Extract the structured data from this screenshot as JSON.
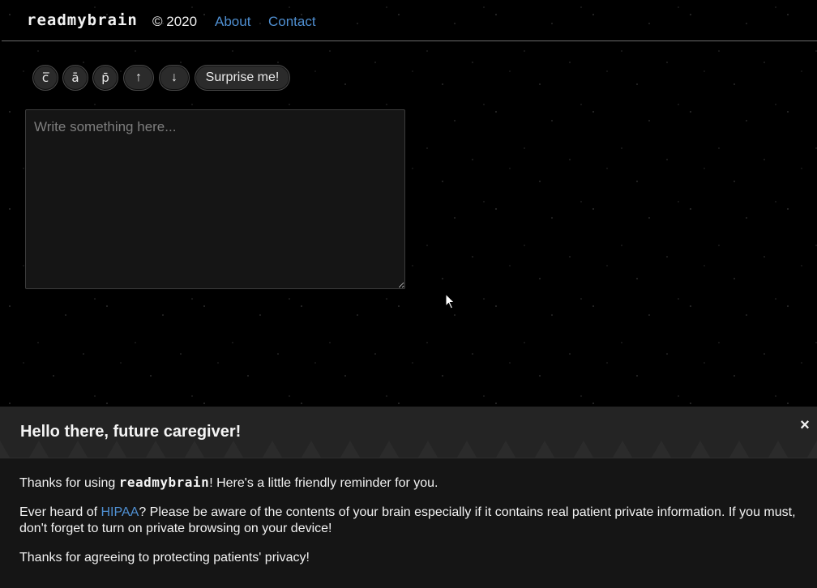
{
  "header": {
    "brand": "readmybrain",
    "copyright": "© 2020",
    "nav": {
      "about": "About",
      "contact": "Contact"
    }
  },
  "toolbar": {
    "btn_c": "c̅",
    "btn_a": "ā",
    "btn_p": "p̄",
    "btn_up": "↑",
    "btn_down": "↓",
    "surprise": "Surprise me!"
  },
  "editor": {
    "placeholder": "Write something here...",
    "value": ""
  },
  "notice": {
    "title": "Hello there, future caregiver!",
    "close": "×",
    "p1_prefix": "Thanks for using ",
    "p1_brand": "readmybrain",
    "p1_suffix": "! Here's a little friendly reminder for you.",
    "p2_prefix": "Ever heard of ",
    "p2_link": "HIPAA",
    "p2_suffix": "? Please be aware of the contents of your brain especially if it contains real patient private information. If you must, don't forget to turn on private browsing on your device!",
    "p3": "Thanks for agreeing to protecting patients' privacy!"
  },
  "colors": {
    "link": "#4f8fd1",
    "background": "#000000",
    "modal": "#151515"
  },
  "icons": {
    "close": "close-icon",
    "up": "arrow-up-icon",
    "down": "arrow-down-icon",
    "cursor": "mouse-pointer-icon"
  }
}
